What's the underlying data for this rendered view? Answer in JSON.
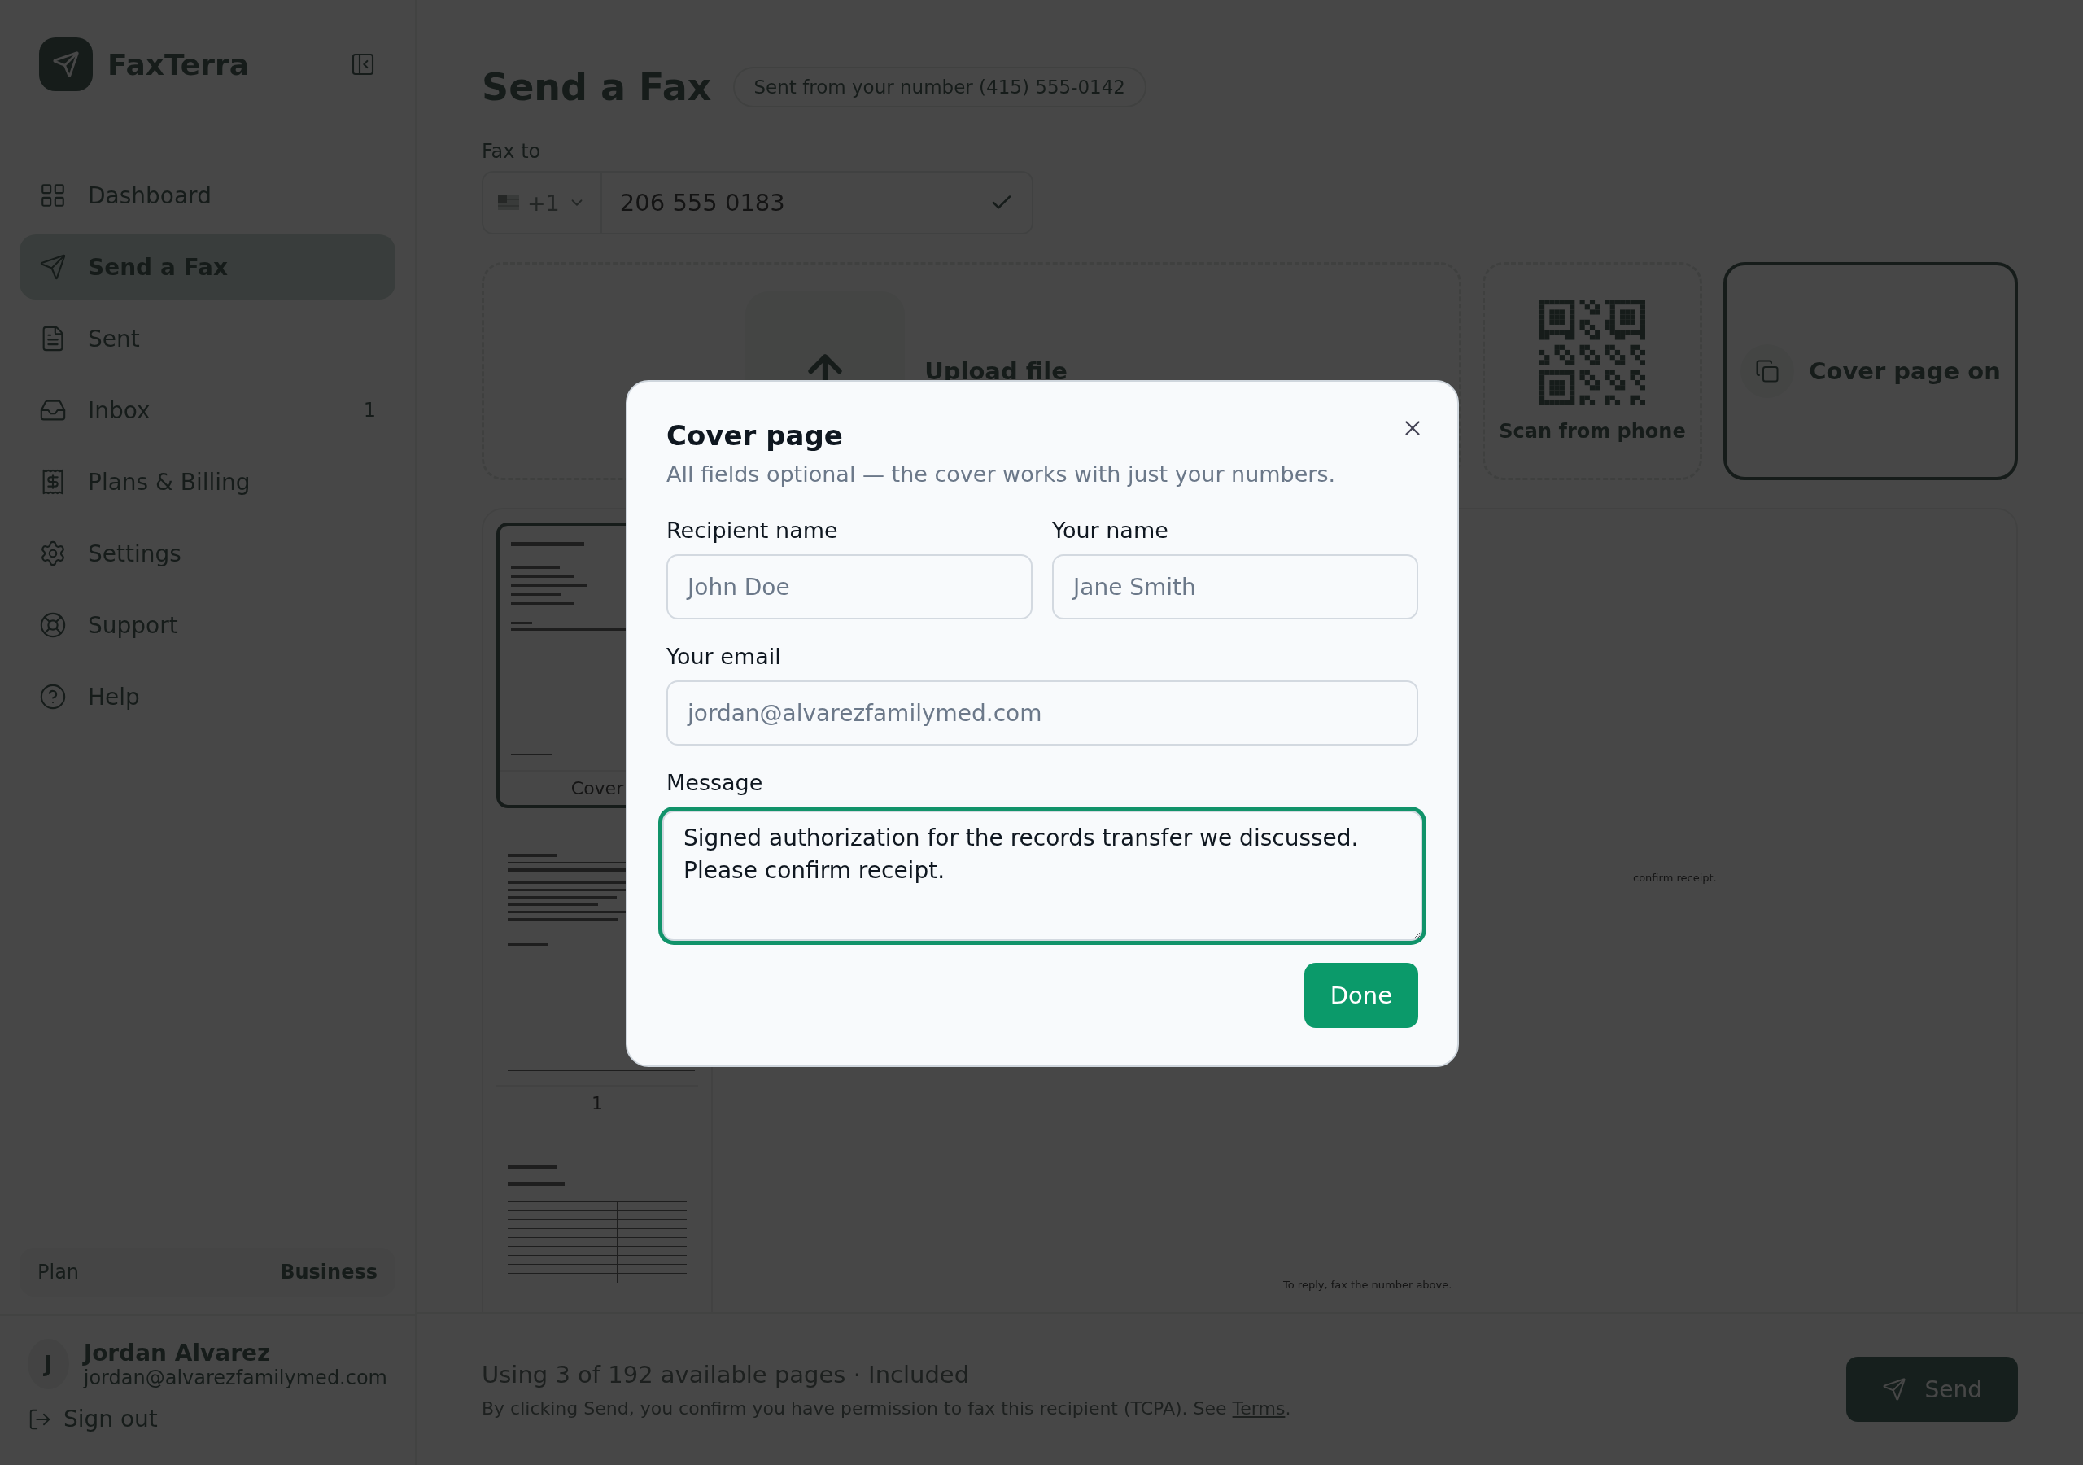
{
  "sidebar": {
    "brand": "FaxTerra",
    "items": [
      {
        "label": "Dashboard",
        "selected": false
      },
      {
        "label": "Send a Fax",
        "selected": true
      },
      {
        "label": "Sent",
        "selected": false
      },
      {
        "label": "Inbox",
        "selected": false,
        "badge": "1"
      },
      {
        "label": "Plans & Billing",
        "selected": false
      },
      {
        "label": "Settings",
        "selected": false
      },
      {
        "label": "Support",
        "selected": false
      },
      {
        "label": "Help",
        "selected": false
      }
    ],
    "plan": {
      "label": "Plan",
      "value": "Business"
    },
    "user": {
      "initial": "J",
      "name": "Jordan Alvarez",
      "email": "jordan@alvarezfamilymed.com"
    },
    "sign_out": "Sign out"
  },
  "header": {
    "title": "Send a Fax",
    "sender_badge": "Sent from your number (415) 555-0142"
  },
  "fax_to": {
    "label": "Fax to",
    "country_code": "+1",
    "value": "206 555 0183",
    "valid": true
  },
  "sources": {
    "upload": "Upload file",
    "scan": "Scan from phone",
    "cover_toggle": {
      "label": "Cover page on",
      "on": true
    }
  },
  "preview": {
    "thumbnails": [
      {
        "kind": "cover",
        "label": "Cover",
        "selected": true
      },
      {
        "kind": "letter",
        "label": "1",
        "selected": false
      },
      {
        "kind": "table",
        "selected": false
      }
    ],
    "message_tail": "confirm receipt.",
    "footer_note": "To reply, fax the number above."
  },
  "footer": {
    "usage": "Using 3 of 192 available pages · Included",
    "consent": "By clicking Send, you confirm you have permission to fax this recipient (TCPA). See ",
    "terms_link": "Terms",
    "consent_end": ".",
    "send": "Send"
  },
  "modal": {
    "title": "Cover page",
    "subtitle": "All fields optional — the cover works with just your numbers.",
    "fields": [
      {
        "label": "Recipient name",
        "placeholder": "John Doe"
      },
      {
        "label": "Your name",
        "placeholder": "Jane Smith"
      },
      {
        "label": "Your email",
        "placeholder": "jordan@alvarezfamilymed.com"
      }
    ],
    "message": {
      "label": "Message",
      "value": "Signed authorization for the records transfer we discussed.\nPlease confirm receipt.",
      "focused": true
    },
    "done": "Done"
  }
}
